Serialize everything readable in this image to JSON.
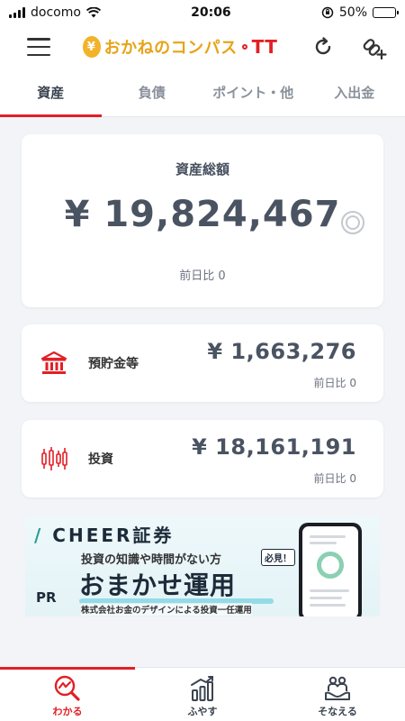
{
  "status_bar": {
    "carrier": "docomo",
    "time": "20:06",
    "battery": "50%"
  },
  "header": {
    "logo_text": "おかねのコンパス",
    "logo_suffix": "TT",
    "icons": [
      "menu-icon",
      "refresh-icon",
      "link-add-icon"
    ]
  },
  "tabs": [
    {
      "label": "資産",
      "active": true
    },
    {
      "label": "負債",
      "active": false
    },
    {
      "label": "ポイント・他",
      "active": false
    },
    {
      "label": "入出金",
      "active": false
    }
  ],
  "summary": {
    "label": "資産総額",
    "amount": "¥ 19,824,467",
    "diff": "前日比 0"
  },
  "categories": [
    {
      "icon": "bank-icon",
      "label": "預貯金等",
      "amount": "¥ 1,663,276",
      "diff": "前日比 0"
    },
    {
      "icon": "candlestick-icon",
      "label": "投資",
      "amount": "¥ 18,161,191",
      "diff": "前日比 0"
    }
  ],
  "banner": {
    "brand": "CHEER",
    "brand_suffix": "証券",
    "subtitle": "投資の知識や時間がない方",
    "badge": "必見！",
    "headline": "おまかせ運用",
    "footer": "株式会社お金のデザインによる投資一任運用",
    "pr_label": "PR"
  },
  "bottom_nav": [
    {
      "icon": "search-chart-icon",
      "label": "わかる",
      "active": true
    },
    {
      "icon": "growth-bars-icon",
      "label": "ふやす",
      "active": false
    },
    {
      "icon": "people-hands-icon",
      "label": "そなえる",
      "active": false
    }
  ],
  "colors": {
    "accent": "#e21f26",
    "logo": "#e8a317",
    "text": "#4a5361",
    "background": "#f2f4f7"
  }
}
